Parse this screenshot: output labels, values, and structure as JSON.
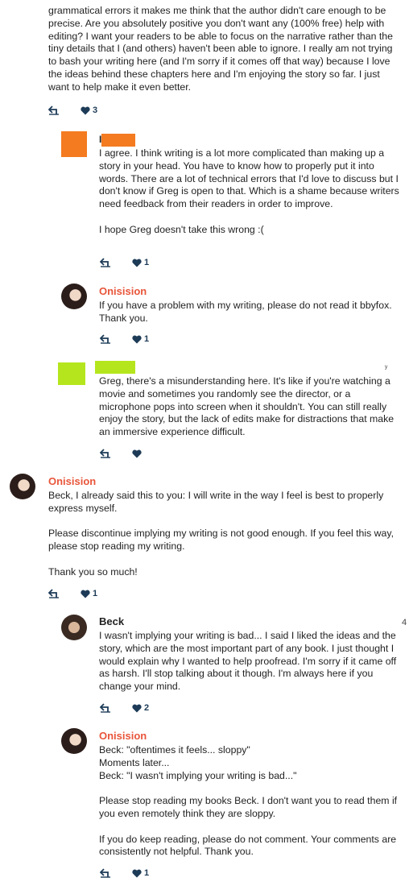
{
  "top_comment": {
    "lines": [
      "grammatical errors it makes me think that the author didn't care enough to be precise. Are you absolutely positive you don't want any (100% free) help with editing? I want your readers to be able to focus on the narrative rather than the tiny details that I (and others) haven't been able to ignore. I really am not trying to bash your writing here (and I'm sorry if it comes off that way) because I love the ideas behind these chapters here and I'm enjoying the story so far. I just want to help make it even better."
    ],
    "likes": "3"
  },
  "comments": [
    {
      "author": "I",
      "avatar": "orange-square",
      "paragraphs": [
        "I agree. I think writing is a lot more complicated than making up a story in your head. You have to know how to properly put it into words. There are a lot of technical errors that I'd love to discuss but I don't know if Greg is open to that. Which is a shame because writers need feedback from their readers in order to improve.",
        "I hope Greg doesn't take this wrong :("
      ],
      "likes": "1"
    },
    {
      "author": "Onisision",
      "paragraphs": [
        "If you have a problem with my writing, please do not read it bbyfox. Thank you."
      ],
      "likes": "1"
    },
    {
      "author": "",
      "paragraphs": [
        "Greg, there's a misunderstanding here. It's like if you're watching a movie and sometimes you randomly see the director, or a microphone pops into screen when it shouldn't. You can still really enjoy the story, but the lack of edits make for distractions that make an immersive experience difficult."
      ],
      "likes": ""
    },
    {
      "author": "Onisision",
      "paragraphs": [
        "Beck, I already said this to you: I will write in the way I feel is best to properly express myself.",
        "Please discontinue implying my writing is not good enough. If you feel this way, please stop reading my writing.",
        "Thank you so much!"
      ],
      "likes": "1"
    },
    {
      "author": "Beck",
      "paragraphs": [
        "I wasn't implying your writing is bad... I said I liked the ideas and the story, which are the most important part of any book. I just thought I would explain why I wanted to help proofread. I'm sorry if it came off as harsh. I'll stop talking about it though. I'm always here if you change your mind."
      ],
      "likes": "2",
      "side_mark": "4"
    },
    {
      "author": "Onisision",
      "paragraphs": [
        "Beck: \"oftentimes it feels... sloppy\"\nMoments later...\nBeck: \"I wasn't implying your writing is bad...\"",
        "Please stop reading my books Beck. I don't want you to read them if you even remotely think they are sloppy.",
        "If you do keep reading, please do not comment. Your comments are consistently not helpful. Thank you."
      ],
      "likes": "1"
    }
  ],
  "colors": {
    "author_accent": "#e8553a",
    "action_icon": "#1d3b57",
    "redact_orange": "#f47b20",
    "redact_green": "#b5e61d"
  },
  "icons": [
    "reply-icon",
    "heart-icon"
  ]
}
